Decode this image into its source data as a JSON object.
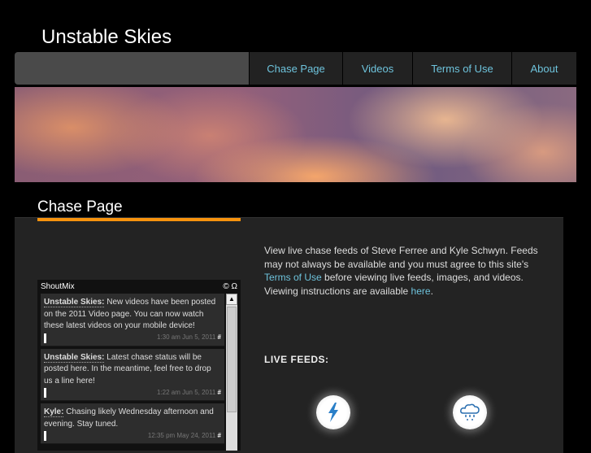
{
  "site_title": "Unstable Skies",
  "nav": [
    {
      "label": "Chase Page"
    },
    {
      "label": "Videos"
    },
    {
      "label": "Terms of Use"
    },
    {
      "label": "About"
    }
  ],
  "page_heading": "Chase Page",
  "intro": {
    "part1": "View live chase feeds of Steve Ferree and Kyle Schwyn. Feeds may not always be available and you must agree to this site's ",
    "terms_link": "Terms of Use",
    "part2": " before viewing live feeds, images, and videos. Viewing instructions are available ",
    "here_link": "here",
    "part3": "."
  },
  "live_feeds_label": "LIVE FEEDS:",
  "feed_icons": [
    "lightning-icon",
    "rain-cloud-icon"
  ],
  "shoutbox": {
    "title": "ShoutMix",
    "header_icons": "© Ω",
    "messages": [
      {
        "author": "Unstable Skies:",
        "text": " New videos have been posted on the 2011 Video page. You can now watch these latest videos on your mobile device!",
        "time": "1:30 am Jun 5, 2011",
        "hash": "#"
      },
      {
        "author": "Unstable Skies:",
        "text": " Latest chase status will be posted here. In the meantime, feel free to drop us a line here!",
        "time": "1:22 am Jun 5, 2011",
        "hash": "#"
      },
      {
        "author": "Kyle:",
        "text": " Chasing likely Wednesday afternoon and evening. Stay tuned.",
        "time": "12:35 pm May 24, 2011",
        "hash": "#"
      }
    ]
  },
  "colors": {
    "accent": "#f7930e",
    "link": "#6ec3dc"
  }
}
